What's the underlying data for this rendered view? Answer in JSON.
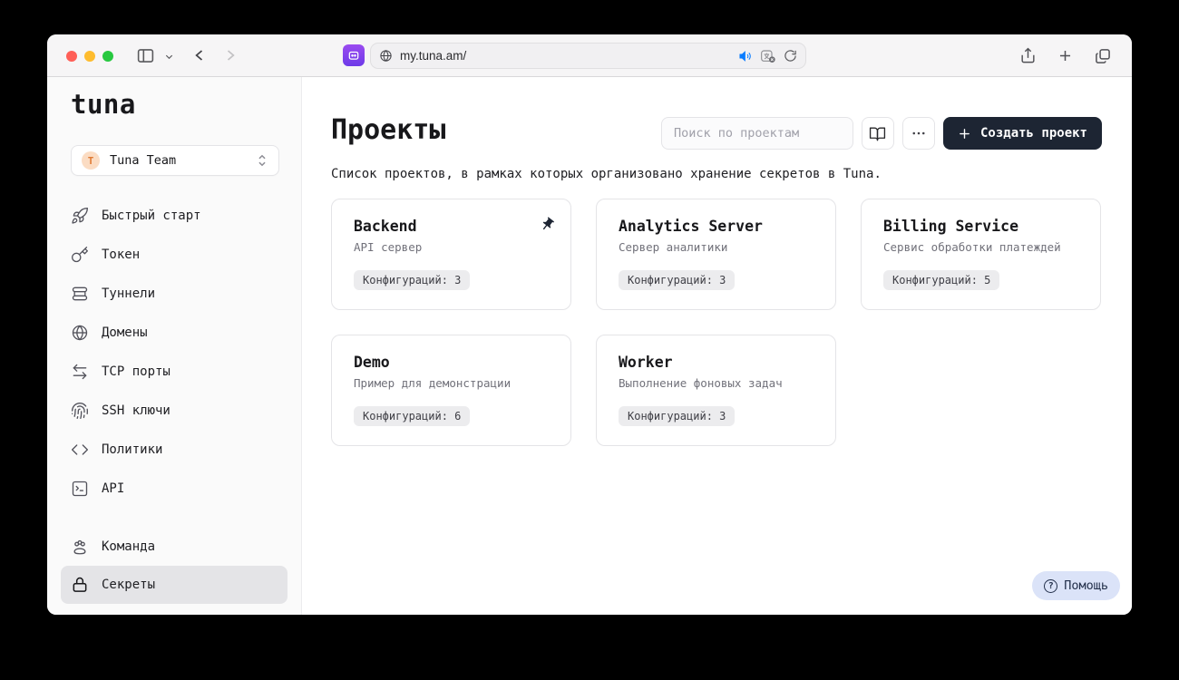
{
  "browser": {
    "url": "my.tuna.am/",
    "traffic_lights": {
      "close": "#ff5f57",
      "minimize": "#febc2e",
      "zoom": "#28c840"
    }
  },
  "sidebar": {
    "logo": "tuna",
    "team": {
      "avatar_initial": "T",
      "name": "Tuna Team"
    },
    "items": [
      {
        "icon": "rocket-icon",
        "label": "Быстрый старт"
      },
      {
        "icon": "key-icon",
        "label": "Токен"
      },
      {
        "icon": "tunnels-icon",
        "label": "Туннели"
      },
      {
        "icon": "globe-icon",
        "label": "Домены"
      },
      {
        "icon": "tcp-ports-icon",
        "label": "TCP порты"
      },
      {
        "icon": "fingerprint-icon",
        "label": "SSH ключи"
      },
      {
        "icon": "code-icon",
        "label": "Политики"
      },
      {
        "icon": "terminal-icon",
        "label": "API"
      }
    ],
    "bottom_items": [
      {
        "icon": "team-icon",
        "label": "Команда",
        "selected": false
      },
      {
        "icon": "lock-icon",
        "label": "Секреты",
        "selected": true
      }
    ]
  },
  "main": {
    "title": "Проекты",
    "subtitle": "Список проектов, в рамках которых организовано хранение секретов в Tuna.",
    "search_placeholder": "Поиск по проектам",
    "create_button_label": "Создать проект",
    "help_button_label": "Помощь",
    "cards": [
      {
        "title": "Backend",
        "description": "API сервер",
        "configs": "Конфигураций: 3",
        "pinned": true
      },
      {
        "title": "Analytics Server",
        "description": "Сервер аналитики",
        "configs": "Конфигураций: 3",
        "pinned": false
      },
      {
        "title": "Billing Service",
        "description": "Сервис обработки платеждей",
        "configs": "Конфигураций: 5",
        "pinned": false
      },
      {
        "title": "Demo",
        "description": "Пример для демонстрации",
        "configs": "Конфигураций: 6",
        "pinned": false
      },
      {
        "title": "Worker",
        "description": "Выполнение фоновых задач",
        "configs": "Конфигураций: 3",
        "pinned": false
      }
    ]
  },
  "colors": {
    "accent_dark": "#1d2533",
    "sidebar_bg": "#fafafa",
    "selected_item_bg": "#e4e4e7",
    "help_bg": "#dbe3f8",
    "badge_bg": "#ececee",
    "avatar_bg": "#fbdcc3",
    "avatar_text": "#e07b35",
    "speaker_blue": "#0a7cff"
  }
}
